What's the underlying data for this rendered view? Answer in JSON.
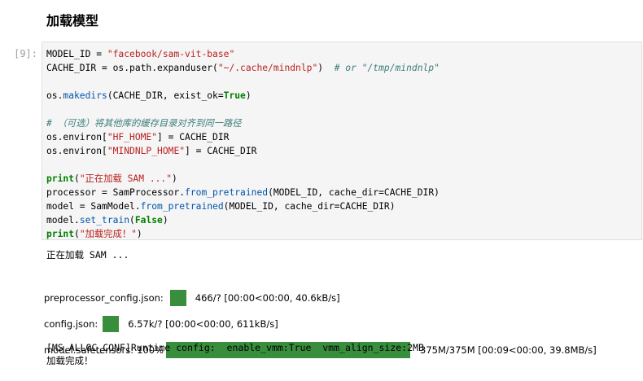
{
  "heading": "加载模型",
  "cell": {
    "prompt": "[9]:",
    "lines": [
      [
        {
          "t": "MODEL_ID = "
        },
        {
          "t": "\"facebook/sam-vit-base\"",
          "c": "str"
        }
      ],
      [
        {
          "t": "CACHE_DIR = os.path.expanduser("
        },
        {
          "t": "\"~/.cache/mindnlp\"",
          "c": "str"
        },
        {
          "t": ")  "
        },
        {
          "t": "# or \"/tmp/mindnlp\"",
          "c": "cmt"
        }
      ],
      [],
      [
        {
          "t": "os."
        },
        {
          "t": "makedirs",
          "c": "fn"
        },
        {
          "t": "(CACHE_DIR, exist_ok="
        },
        {
          "t": "True",
          "c": "kw"
        },
        {
          "t": ")"
        }
      ],
      [],
      [
        {
          "t": "# （可选）将其他库的缓存目录对齐到同一路径",
          "c": "cmt"
        }
      ],
      [
        {
          "t": "os.environ["
        },
        {
          "t": "\"HF_HOME\"",
          "c": "str"
        },
        {
          "t": "] = CACHE_DIR"
        }
      ],
      [
        {
          "t": "os.environ["
        },
        {
          "t": "\"MINDNLP_HOME\"",
          "c": "str"
        },
        {
          "t": "] = CACHE_DIR"
        }
      ],
      [],
      [
        {
          "t": "print",
          "c": "kw"
        },
        {
          "t": "("
        },
        {
          "t": "\"正在加载 SAM ...\"",
          "c": "str"
        },
        {
          "t": ")"
        }
      ],
      [
        {
          "t": "processor = SamProcessor."
        },
        {
          "t": "from_pretrained",
          "c": "fn"
        },
        {
          "t": "(MODEL_ID, cache_dir=CACHE_DIR)"
        }
      ],
      [
        {
          "t": "model = SamModel."
        },
        {
          "t": "from_pretrained",
          "c": "fn"
        },
        {
          "t": "(MODEL_ID, cache_dir=CACHE_DIR)"
        }
      ],
      [
        {
          "t": "model."
        },
        {
          "t": "set_train",
          "c": "fn"
        },
        {
          "t": "("
        },
        {
          "t": "False",
          "c": "kw"
        },
        {
          "t": ")"
        }
      ],
      [
        {
          "t": "print",
          "c": "kw"
        },
        {
          "t": "("
        },
        {
          "t": "\"加载完成！\"",
          "c": "str"
        },
        {
          "t": ")"
        }
      ]
    ]
  },
  "output": {
    "loading_text": "正在加载 SAM ...",
    "progress": [
      {
        "label": "preprocessor_config.json:",
        "percent": "",
        "fill": 1.0,
        "stats": "466/? [00:00<00:00, 40.6kB/s]"
      },
      {
        "label": "config.json:",
        "percent": "",
        "fill": 1.0,
        "stats": "6.57k/? [00:00<00:00, 611kB/s]"
      },
      {
        "label": "model.safetensors:",
        "percent": "100%",
        "fill": 1.0,
        "stats": "375M/375M [00:09<00:00, 39.8MB/s]"
      }
    ],
    "config_line": "[MS_ALLOC_CONF]Runtime config:  enable_vmm:True  vmm_align_size:2MB",
    "done_text": "加载完成！"
  },
  "colors": {
    "bar": "#388e3c",
    "string": "#ba2121",
    "comment": "#3d7b7b",
    "keyword": "#008000"
  }
}
